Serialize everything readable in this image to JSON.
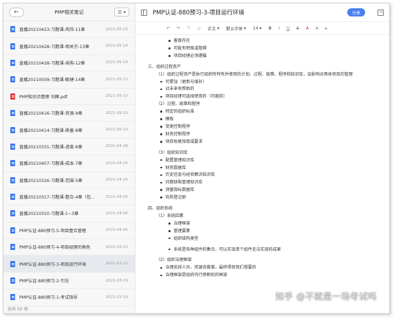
{
  "sidebar": {
    "title": "PMP相关笔记",
    "back_icon": "arrow-left-icon",
    "menu_icon": "list-menu-icon",
    "footer": "总共 50 项",
    "notes": [
      {
        "title": "直播20210423-习题课-风险-11章",
        "date": "2021-05-15",
        "icon": "doc"
      },
      {
        "title": "直播20210428-习题课-相关方-13章",
        "date": "2021-05-14",
        "icon": "doc"
      },
      {
        "title": "直播20210428-习题课-采购-12章",
        "date": "2021-05-14",
        "icon": "doc"
      },
      {
        "title": "直播20210509-习题课-敏捷-14章",
        "date": "2021-05-13",
        "icon": "doc"
      },
      {
        "title": "PMP知识点整理 刘雁.pdf",
        "date": "2021-05-10",
        "icon": "pdf"
      },
      {
        "title": "直播20210416-习题课-资源-9章",
        "date": "2021-05-10",
        "icon": "doc"
      },
      {
        "title": "直播20210414-习题课-质量-8章",
        "date": "2021-05-10",
        "icon": "doc"
      },
      {
        "title": "直播20210331-习题课-进度-6章",
        "date": "2021-04-28",
        "icon": "doc"
      },
      {
        "title": "直播20210407-习题课-成本-7章",
        "date": "2021-04-25",
        "icon": "doc"
      },
      {
        "title": "直播20210326-习题课-范围-5章",
        "date": "2021-04-25",
        "icon": "doc"
      },
      {
        "title": "直播20210317-习题课-整合-4章（包...",
        "date": "2021-04-25",
        "icon": "doc"
      },
      {
        "title": "直播20210310-习题课-1~3章",
        "date": "2021-04-06",
        "icon": "doc"
      },
      {
        "title": "PMP认证-880预习-5-项目整合管理",
        "date": "2021-04-05",
        "icon": "doc"
      },
      {
        "title": "PMP认证-880预习-4-项目经理的角色",
        "date": "2021-03-23",
        "icon": "doc"
      },
      {
        "title": "PMP认证-880预习-3-项目运行环境",
        "date": "2021-03-21",
        "icon": "doc",
        "active": true
      },
      {
        "title": "PMP认证-880预习-2-引论",
        "date": "2021-03-19",
        "icon": "doc"
      },
      {
        "title": "PMP认证-880预习-1-考试指导",
        "date": "2021-03-19",
        "icon": "doc"
      }
    ]
  },
  "header": {
    "title": "PMP认证-880预习-3-项目运行环境",
    "share_label": "分享",
    "sidebar_toggle_icon": "sidebar-toggle-icon",
    "export_icon": "export-icon"
  },
  "toolbar": {
    "undo": "↶",
    "redo": "↷",
    "format_paint": "⊤",
    "clear": "◇",
    "paragraph": "正文",
    "font": "默认字体",
    "size": "14",
    "bold": "B",
    "italic": "I",
    "underline": "U",
    "strike": "S",
    "font_color": "A",
    "highlight": "A",
    "more": "▸"
  },
  "content": [
    {
      "level": "l3",
      "bullet": true,
      "text": "客观存在"
    },
    {
      "level": "l3",
      "bullet": true,
      "text": "可能有积极或阻碍"
    },
    {
      "level": "l3",
      "bullet": true,
      "text": "项目经理必须遵循"
    },
    {
      "level": "gap"
    },
    {
      "level": "l0",
      "bullet": false,
      "text": "三、组织过程资产"
    },
    {
      "level": "l1",
      "bullet": false,
      "text": "（1）组织过程资产是执行组织所特有并使用的计划、过程、政策、程序和知识库，会影响对具体项目的管理"
    },
    {
      "level": "l2",
      "bullet": true,
      "text": "可累加（更新与增补）"
    },
    {
      "level": "l2",
      "bullet": true,
      "text": "对未来有帮助的"
    },
    {
      "level": "l2",
      "bullet": true,
      "text": "项目经理可选择使用的（可裁剪）"
    },
    {
      "level": "l1",
      "bullet": false,
      "text": "（2）过程、政策和程序"
    },
    {
      "level": "l2",
      "bullet": true,
      "text": "特定的组织标准"
    },
    {
      "level": "l2",
      "bullet": true,
      "text": "模板"
    },
    {
      "level": "l2",
      "bullet": true,
      "text": "变更控制程序"
    },
    {
      "level": "l2",
      "bullet": true,
      "text": "财务控制程序"
    },
    {
      "level": "l2",
      "bullet": true,
      "text": "项目收尾指南或要求"
    },
    {
      "level": "gap"
    },
    {
      "level": "l1",
      "bullet": false,
      "text": "（3）组织知识库"
    },
    {
      "level": "l2",
      "bullet": true,
      "text": "配置管理知识库"
    },
    {
      "level": "l2",
      "bullet": true,
      "text": "财务数据库"
    },
    {
      "level": "l2",
      "bullet": true,
      "text": "历史信息与经验教训知识库"
    },
    {
      "level": "l2",
      "bullet": true,
      "text": "问题缺陷管理知识库"
    },
    {
      "level": "l2",
      "bullet": true,
      "text": "测量指标数据库"
    },
    {
      "level": "l2",
      "bullet": true,
      "text": "风险登记册"
    },
    {
      "level": "gap"
    },
    {
      "level": "l0",
      "bullet": false,
      "text": "四、组织系统"
    },
    {
      "level": "l1",
      "bullet": false,
      "text": "（1）系统因素"
    },
    {
      "level": "l3",
      "bullet": true,
      "text": "治理框架"
    },
    {
      "level": "l3",
      "bullet": true,
      "text": "管理要素"
    },
    {
      "level": "l3",
      "bullet": true,
      "text": "组织结构类型"
    },
    {
      "level": "gap"
    },
    {
      "level": "l3",
      "bullet": true,
      "text": "系统是各种组件的集合，可以实现单个组件无法实现的成果"
    },
    {
      "level": "gap"
    },
    {
      "level": "l1",
      "bullet": false,
      "text": "（2）组织治理框架"
    },
    {
      "level": "l2",
      "bullet": true,
      "text": "治理安排人员，资源去做事，最终得到我们想要的"
    },
    {
      "level": "l2",
      "bullet": true,
      "text": "治理框架是组织内行使职权的框架"
    }
  ],
  "watermark": "知乎 @不就是一场考试吗"
}
